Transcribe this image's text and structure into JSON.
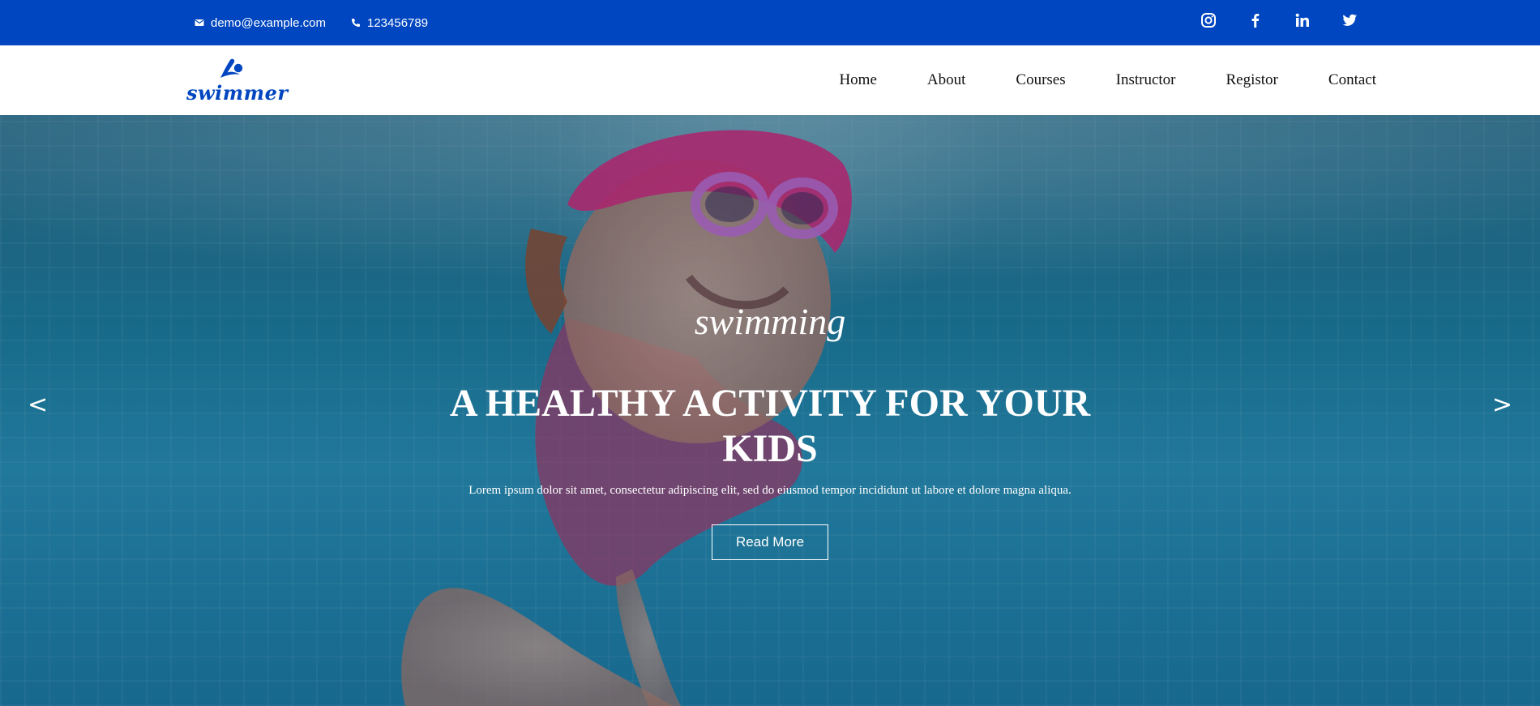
{
  "topbar": {
    "email": "demo@example.com",
    "phone": "123456789",
    "social": [
      "instagram-icon",
      "facebook-icon",
      "linkedin-icon",
      "twitter-icon"
    ],
    "bg_color": "#0046c0"
  },
  "navbar": {
    "logo_text": "swimmer",
    "items": [
      {
        "label": "Home"
      },
      {
        "label": "About"
      },
      {
        "label": "Courses"
      },
      {
        "label": "Instructor"
      },
      {
        "label": "Registor"
      },
      {
        "label": "Contact"
      }
    ]
  },
  "hero": {
    "subtitle": "swimming",
    "headline": "A HEALTHY ACTIVITY FOR YOUR KIDS",
    "description": "Lorem ipsum dolor sit amet, consectetur adipiscing elit, sed do eiusmod tempor incididunt ut labore et dolore magna aliqua.",
    "button_label": "Read More",
    "prev_label": "<",
    "next_label": ">"
  }
}
